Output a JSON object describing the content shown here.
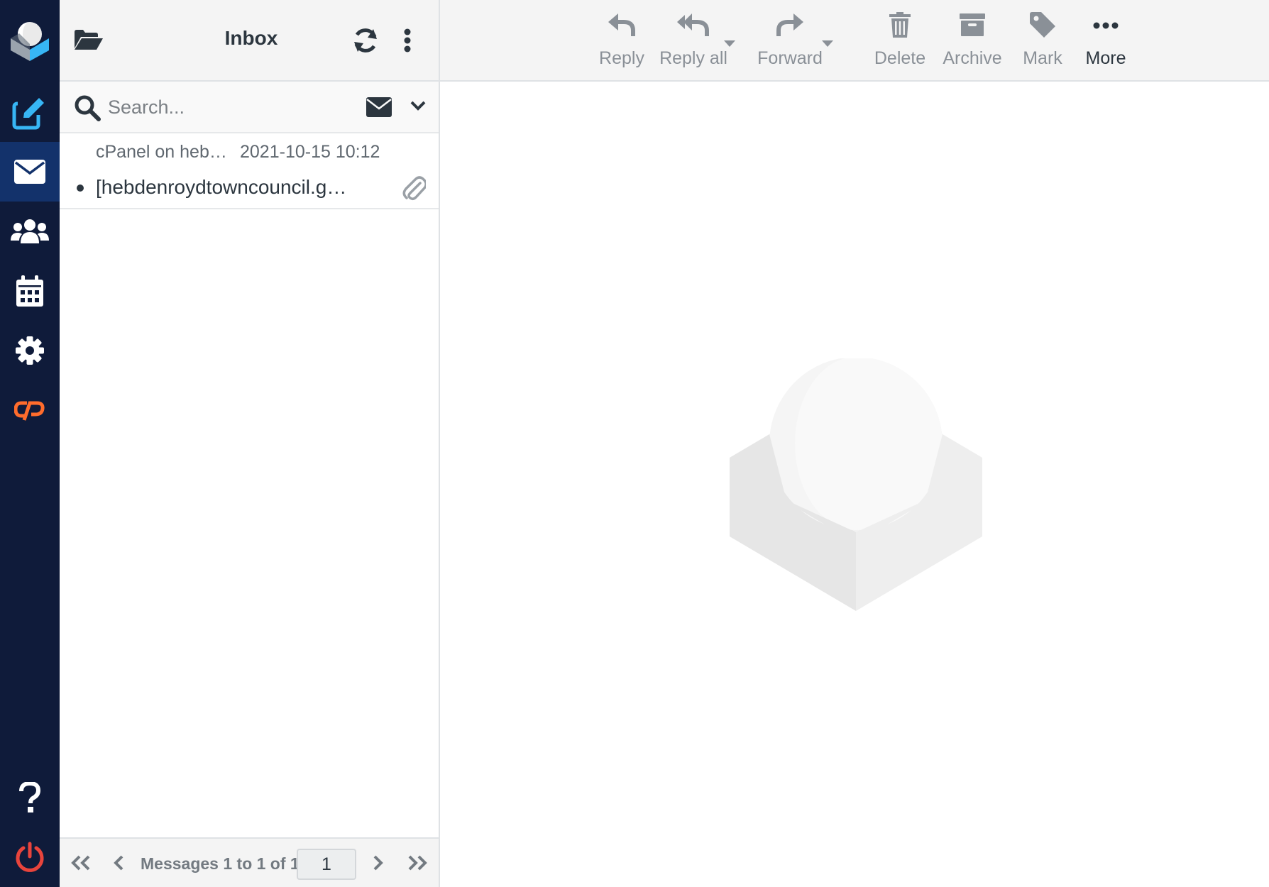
{
  "colors": {
    "nav_background": "#0f1b3a",
    "nav_selected": "#13326b",
    "accent_blue": "#37b6f5",
    "cpanel_orange": "#ff6c2c",
    "logout_red": "#e8443c"
  },
  "nav": {
    "items": [
      {
        "icon": "compose-icon"
      },
      {
        "icon": "mail-icon",
        "selected": true
      },
      {
        "icon": "contacts-icon"
      },
      {
        "icon": "calendar-icon"
      },
      {
        "icon": "settings-icon"
      },
      {
        "icon": "cpanel-icon"
      },
      {
        "icon": "help-icon"
      },
      {
        "icon": "logout-icon"
      }
    ]
  },
  "list": {
    "title": "Inbox",
    "search_placeholder": "Search...",
    "messages": [
      {
        "from": "cPanel on heb…",
        "date": "2021-10-15 10:12",
        "subject": "[hebdenroydtowncouncil.g…",
        "has_attachment": true,
        "unread_dot": true
      }
    ],
    "pager": {
      "text": "Messages 1 to 1 of 1",
      "page": "1"
    }
  },
  "toolbar": {
    "reply": "Reply",
    "reply_all": "Reply all",
    "forward": "Forward",
    "delete": "Delete",
    "archive": "Archive",
    "mark": "Mark",
    "more": "More"
  }
}
